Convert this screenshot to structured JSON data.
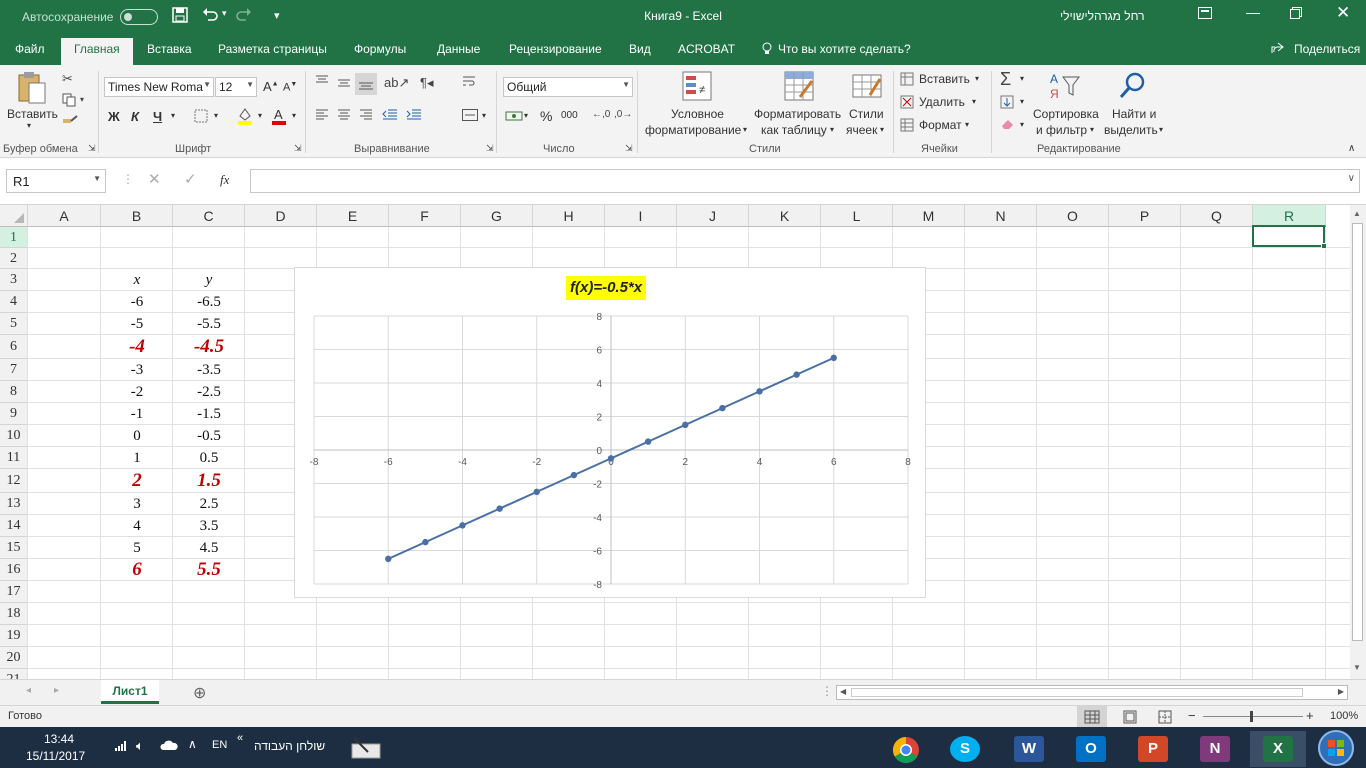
{
  "titlebar": {
    "autosave_label": "Автосохранение",
    "doc_title": "Книга9  -  Excel",
    "user_name": "רחל מגרהלישוילי",
    "save_icon": "save-icon",
    "undo_icon": "undo-icon",
    "redo_icon": "redo-icon"
  },
  "ribbon_tabs": [
    {
      "label": "Файл"
    },
    {
      "label": "Главная"
    },
    {
      "label": "Вставка"
    },
    {
      "label": "Разметка страницы"
    },
    {
      "label": "Формулы"
    },
    {
      "label": "Данные"
    },
    {
      "label": "Рецензирование"
    },
    {
      "label": "Вид"
    },
    {
      "label": "ACROBAT"
    },
    {
      "label": "Что вы хотите сделать?"
    }
  ],
  "share_label": "Поделиться",
  "ribbon": {
    "paste_label": "Вставить",
    "font_name": "Times New Roma",
    "font_size": "12",
    "bold": "Ж",
    "italic": "К",
    "underline": "Ч",
    "number_format": "Общий",
    "percent": "%",
    "thousands": "000",
    "cond_format_1": "Условное",
    "cond_format_2": "форматирование",
    "format_table_1": "Форматировать",
    "format_table_2": "как таблицу",
    "cell_styles_1": "Стили",
    "cell_styles_2": "ячеек",
    "insert_label": "Вставить",
    "delete_label": "Удалить",
    "format_label": "Формат",
    "sort_1": "Сортировка",
    "sort_2": "и фильтр",
    "find_1": "Найти и",
    "find_2": "выделить",
    "groups": {
      "clipboard": "Буфер обмена",
      "font": "Шрифт",
      "alignment": "Выравнивание",
      "number": "Число",
      "styles": "Стили",
      "cells": "Ячейки",
      "editing": "Редактирование"
    }
  },
  "formula_bar": {
    "name_box": "R1",
    "fx": "fx",
    "value": ""
  },
  "columns": [
    "A",
    "B",
    "C",
    "D",
    "E",
    "F",
    "G",
    "H",
    "I",
    "J",
    "K",
    "L",
    "M",
    "N",
    "O",
    "P",
    "Q",
    "R"
  ],
  "rows": [
    "1",
    "2",
    "3",
    "4",
    "5",
    "6",
    "7",
    "8",
    "9",
    "10",
    "11",
    "12",
    "13",
    "14",
    "15",
    "16",
    "17",
    "18",
    "19",
    "20",
    "21"
  ],
  "table": {
    "header_x": "x",
    "header_y": "y",
    "rows": [
      {
        "x": "-6",
        "y": "-6.5",
        "hl": false
      },
      {
        "x": "-5",
        "y": "-5.5",
        "hl": false
      },
      {
        "x": "-4",
        "y": "-4.5",
        "hl": true
      },
      {
        "x": "-3",
        "y": "-3.5",
        "hl": false
      },
      {
        "x": "-2",
        "y": "-2.5",
        "hl": false
      },
      {
        "x": "-1",
        "y": "-1.5",
        "hl": false
      },
      {
        "x": "0",
        "y": "-0.5",
        "hl": false
      },
      {
        "x": "1",
        "y": "0.5",
        "hl": false
      },
      {
        "x": "2",
        "y": "1.5",
        "hl": true
      },
      {
        "x": "3",
        "y": "2.5",
        "hl": false
      },
      {
        "x": "4",
        "y": "3.5",
        "hl": false
      },
      {
        "x": "5",
        "y": "4.5",
        "hl": false
      },
      {
        "x": "6",
        "y": "5.5",
        "hl": true
      }
    ]
  },
  "chart_data": {
    "type": "scatter",
    "title": "f(x)=-0.5*x",
    "xlabel": "",
    "ylabel": "",
    "xlim": [
      -8,
      8
    ],
    "ylim": [
      -8,
      8
    ],
    "xticks": [
      -8,
      -6,
      -4,
      -2,
      0,
      2,
      4,
      6,
      8
    ],
    "yticks": [
      -8,
      -6,
      -4,
      -2,
      0,
      2,
      4,
      6,
      8
    ],
    "grid": true,
    "line_color": "#4a6fa5",
    "series": [
      {
        "x": [
          -6,
          -5,
          -4,
          -3,
          -2,
          -1,
          0,
          1,
          2,
          3,
          4,
          5,
          6
        ],
        "y": [
          -6.5,
          -5.5,
          -4.5,
          -3.5,
          -2.5,
          -1.5,
          -0.5,
          0.5,
          1.5,
          2.5,
          3.5,
          4.5,
          5.5
        ]
      }
    ]
  },
  "sheet_tab": "Лист1",
  "status": {
    "ready": "Готово",
    "zoom": "100%"
  },
  "taskbar": {
    "time": "13:44",
    "date": "15/11/2017",
    "lang": "EN",
    "toolbar_label": "שולחן העבודה"
  },
  "colors": {
    "excel_green": "#217346",
    "highlight_red": "#c00000",
    "chart_title_bg": "#ffff00"
  }
}
